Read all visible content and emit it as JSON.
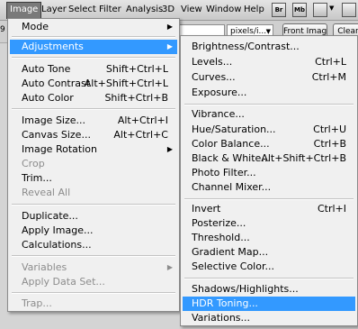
{
  "menubar": {
    "items": [
      "Image",
      "Layer",
      "Select",
      "Filter",
      "Analysis",
      "3D",
      "View",
      "Window",
      "Help"
    ],
    "active": "Image",
    "icons": [
      {
        "name": "bridge-icon",
        "glyph": "Br"
      },
      {
        "name": "minibridge-icon",
        "glyph": "Mb"
      }
    ]
  },
  "options": {
    "edge_label": "9",
    "unit_select": "pixels/i...",
    "front_image_label": "Front Image",
    "clear_label": "Clear"
  },
  "image_menu": {
    "items": [
      {
        "label": "Mode",
        "submenu": true
      },
      {
        "label": "Adjustments",
        "submenu": true,
        "highlighted": true
      },
      {
        "label": "Auto Tone",
        "shortcut": "Shift+Ctrl+L"
      },
      {
        "label": "Auto Contrast",
        "shortcut": "Alt+Shift+Ctrl+L"
      },
      {
        "label": "Auto Color",
        "shortcut": "Shift+Ctrl+B"
      },
      {
        "label": "Image Size...",
        "shortcut": "Alt+Ctrl+I"
      },
      {
        "label": "Canvas Size...",
        "shortcut": "Alt+Ctrl+C"
      },
      {
        "label": "Image Rotation",
        "submenu": true
      },
      {
        "label": "Crop",
        "disabled": true
      },
      {
        "label": "Trim..."
      },
      {
        "label": "Reveal All",
        "disabled": true
      },
      {
        "label": "Duplicate..."
      },
      {
        "label": "Apply Image..."
      },
      {
        "label": "Calculations..."
      },
      {
        "label": "Variables",
        "submenu": true,
        "disabled": true
      },
      {
        "label": "Apply Data Set...",
        "disabled": true
      },
      {
        "label": "Trap...",
        "disabled": true
      }
    ]
  },
  "adjustments_menu": {
    "items": [
      {
        "label": "Brightness/Contrast..."
      },
      {
        "label": "Levels...",
        "shortcut": "Ctrl+L"
      },
      {
        "label": "Curves...",
        "shortcut": "Ctrl+M"
      },
      {
        "label": "Exposure..."
      },
      {
        "label": "Vibrance..."
      },
      {
        "label": "Hue/Saturation...",
        "shortcut": "Ctrl+U"
      },
      {
        "label": "Color Balance...",
        "shortcut": "Ctrl+B"
      },
      {
        "label": "Black & White...",
        "shortcut": "Alt+Shift+Ctrl+B"
      },
      {
        "label": "Photo Filter..."
      },
      {
        "label": "Channel Mixer..."
      },
      {
        "label": "Invert",
        "shortcut": "Ctrl+I"
      },
      {
        "label": "Posterize..."
      },
      {
        "label": "Threshold..."
      },
      {
        "label": "Gradient Map..."
      },
      {
        "label": "Selective Color..."
      },
      {
        "label": "Shadows/Highlights..."
      },
      {
        "label": "HDR Toning...",
        "highlighted": true
      },
      {
        "label": "Variations..."
      }
    ]
  },
  "colors": {
    "highlight": "#3399ff",
    "menu_bg": "#f0f0f0",
    "disabled_text": "#8c8c8c"
  }
}
